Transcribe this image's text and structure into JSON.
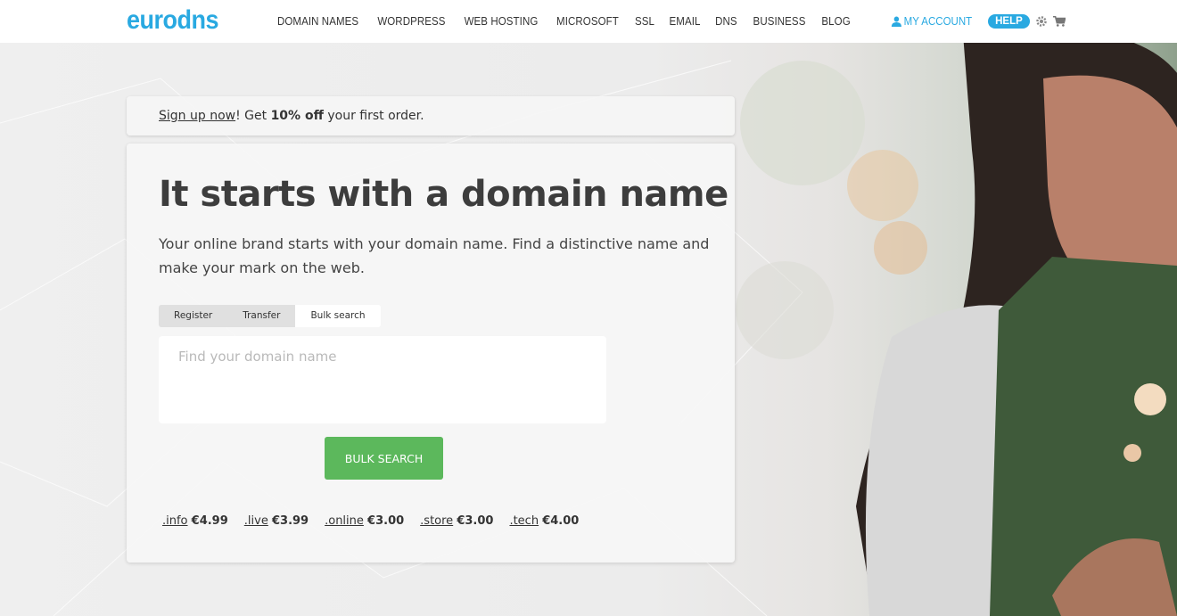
{
  "header": {
    "logo": "eurodns",
    "nav": [
      "DOMAIN NAMES",
      "WORDPRESS",
      "WEB HOSTING",
      "MICROSOFT",
      "SSL",
      "EMAIL",
      "DNS",
      "BUSINESS",
      "BLOG"
    ],
    "account_label": "MY ACCOUNT",
    "help_label": "HELP",
    "icons": [
      "user-icon",
      "gear-icon",
      "cart-icon"
    ],
    "accent_color": "#29a9e1"
  },
  "promo": {
    "link_text": "Sign up now",
    "after_link": "! Get ",
    "highlight": "10% off",
    "tail": " your first order."
  },
  "hero": {
    "title": "It starts with a domain name",
    "subtitle": "Your online brand starts with your domain name. Find a distinctive name and make your mark on the web."
  },
  "search": {
    "tabs": [
      "Register",
      "Transfer",
      "Bulk search"
    ],
    "active_tab": "Bulk search",
    "placeholder": "Find your domain name",
    "value": "",
    "button_label": "BULK SEARCH",
    "button_color": "#5cb85c"
  },
  "prices": [
    {
      "tld": ".info",
      "price": "€4.99"
    },
    {
      "tld": ".live",
      "price": "€3.99"
    },
    {
      "tld": ".online",
      "price": "€3.00"
    },
    {
      "tld": ".store",
      "price": "€3.00"
    },
    {
      "tld": ".tech",
      "price": "€4.00"
    }
  ]
}
